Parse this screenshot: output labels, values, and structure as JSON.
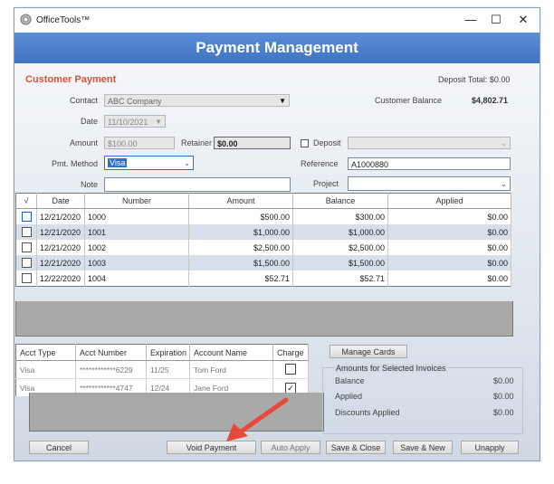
{
  "app": {
    "title": "OfficeTools™",
    "minimize": "—",
    "maximize": "☐",
    "close": "✕"
  },
  "banner": {
    "title": "Payment Management"
  },
  "customer_payment": {
    "section_title": "Customer Payment",
    "deposit_total": "Deposit Total: $0.00",
    "contact_label": "Contact",
    "contact_value": "ABC Company",
    "customer_balance_label": "Customer Balance",
    "customer_balance_value": "$4,802.71",
    "date_label": "Date",
    "date_value": "11/10/2021",
    "amount_label": "Amount",
    "amount_value": "$100.00",
    "retainer_label": "Retainer",
    "retainer_value": "$0.00",
    "deposit_label": "Deposit",
    "deposit_value": "",
    "pmt_method_label": "Pmt. Method",
    "pmt_method_value": "Visa",
    "reference_label": "Reference",
    "reference_value": "A1000880",
    "note_label": "Note",
    "note_value": "",
    "project_label": "Project",
    "project_value": ""
  },
  "invoices": {
    "columns": [
      "√",
      "Date",
      "Number",
      "Amount",
      "Balance",
      "Applied"
    ],
    "rows": [
      {
        "checked": false,
        "date": "12/21/2020",
        "number": "1000",
        "amount": "$500.00",
        "balance": "$300.00",
        "applied": "$0.00"
      },
      {
        "checked": false,
        "date": "12/21/2020",
        "number": "1001",
        "amount": "$1,000.00",
        "balance": "$1,000.00",
        "applied": "$0.00"
      },
      {
        "checked": false,
        "date": "12/21/2020",
        "number": "1002",
        "amount": "$2,500.00",
        "balance": "$2,500.00",
        "applied": "$0.00"
      },
      {
        "checked": false,
        "date": "12/21/2020",
        "number": "1003",
        "amount": "$1,500.00",
        "balance": "$1,500.00",
        "applied": "$0.00"
      },
      {
        "checked": false,
        "date": "12/22/2020",
        "number": "1004",
        "amount": "$52.71",
        "balance": "$52.71",
        "applied": "$0.00"
      }
    ]
  },
  "cards": {
    "columns": [
      "Acct Type",
      "Acct Number",
      "Expiration",
      "Account Name",
      "Charge"
    ],
    "rows": [
      {
        "type": "Visa",
        "number": "************6229",
        "expiration": "11/25",
        "name": "Tom Ford",
        "charge": false
      },
      {
        "type": "Visa",
        "number": "************4747",
        "expiration": "12/24",
        "name": "Jane Ford",
        "charge": true
      }
    ],
    "manage_label": "Manage Cards"
  },
  "amounts": {
    "title": "Amounts for Selected Invoices",
    "balance_label": "Balance",
    "balance_value": "$0.00",
    "applied_label": "Applied",
    "applied_value": "$0.00",
    "discounts_label": "Discounts Applied",
    "discounts_value": "$0.00"
  },
  "buttons": {
    "cancel": "Cancel",
    "void": "Void Payment",
    "auto_apply": "Auto Apply",
    "save_close": "Save & Close",
    "save_new": "Save & New",
    "unapply": "Unapply"
  },
  "colors": {
    "banner": "#4a7fcf",
    "section_title": "#e0503a",
    "arrow": "#e8483a",
    "row_alt": "#d7dfea"
  }
}
